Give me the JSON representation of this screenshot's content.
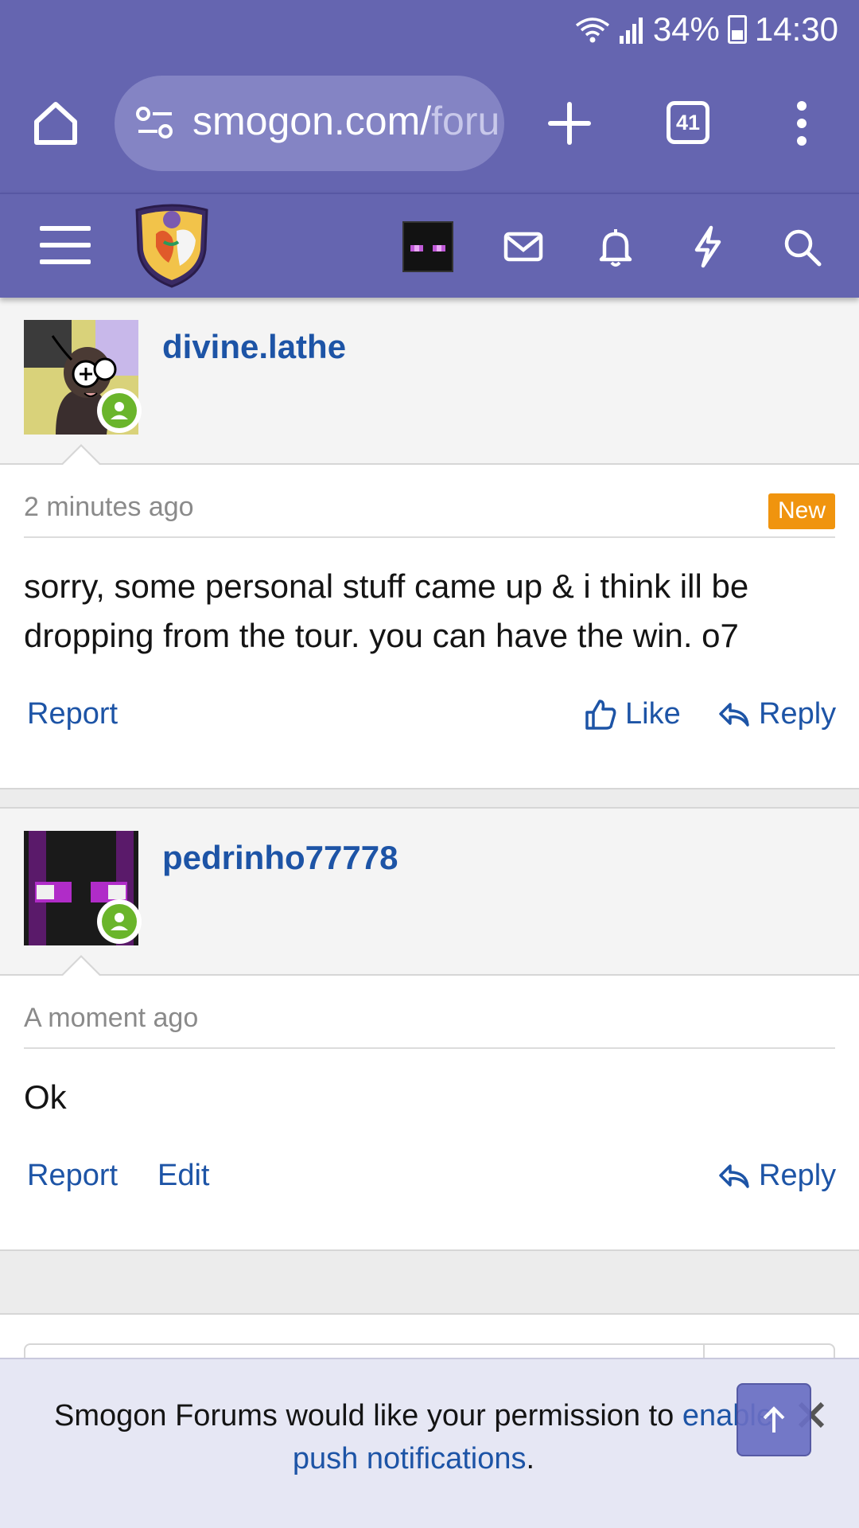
{
  "status_bar": {
    "battery": "34%",
    "time": "14:30"
  },
  "browser": {
    "url_main": "smogon.com/",
    "url_faded": "foru",
    "tab_count": "41"
  },
  "posts": [
    {
      "username": "divine.lathe",
      "time": "2 minutes ago",
      "badge": "New",
      "body": "sorry, some personal stuff came up & i think ill be dropping from the tour. you can have the win. o7",
      "actions": {
        "report": "Report",
        "like": "Like",
        "reply": "Reply"
      }
    },
    {
      "username": "pedrinho77778",
      "time": "A moment ago",
      "body": "Ok",
      "actions": {
        "report": "Report",
        "edit": "Edit",
        "reply": "Reply"
      }
    }
  ],
  "push_banner": {
    "text_before": "Smogon Forums would like your permission to ",
    "link_text": "enable push notifications",
    "text_after": "."
  },
  "colors": {
    "brand": "#6565b0",
    "link": "#1d54a6",
    "new_badge": "#f0940e",
    "online": "#6ab52b"
  }
}
